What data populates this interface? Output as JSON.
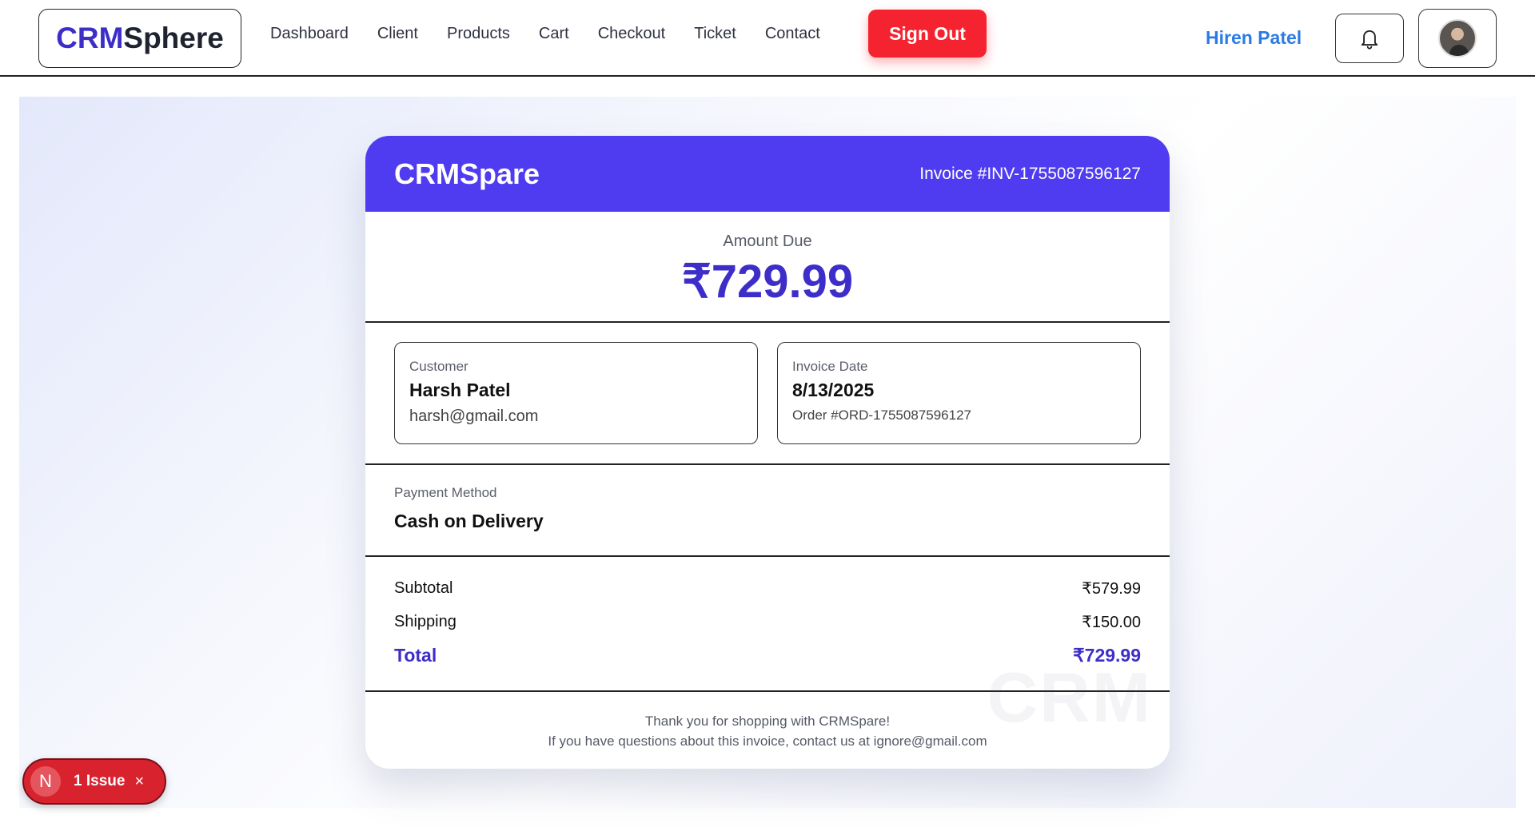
{
  "nav": {
    "logo_part1": "CRM",
    "logo_part2": "Sphere",
    "links": [
      "Dashboard",
      "Client",
      "Products",
      "Cart",
      "Checkout",
      "Ticket",
      "Contact"
    ],
    "signout_label": "Sign Out",
    "user_name": "Hiren Patel"
  },
  "invoice": {
    "brand": "CRMSpare",
    "invoice_number": "Invoice #INV-1755087596127",
    "amount_label": "Amount Due",
    "amount_value": "₹729.99",
    "customer": {
      "label": "Customer",
      "name": "Harsh Patel",
      "email": "harsh@gmail.com"
    },
    "date": {
      "label": "Invoice Date",
      "value": "8/13/2025",
      "order": "Order #ORD-1755087596127"
    },
    "payment": {
      "label": "Payment Method",
      "value": "Cash on Delivery"
    },
    "totals": {
      "subtotal_label": "Subtotal",
      "subtotal_value": "₹579.99",
      "shipping_label": "Shipping",
      "shipping_value": "₹150.00",
      "total_label": "Total",
      "total_value": "₹729.99"
    },
    "footer": {
      "line1": "Thank you for shopping with CRMSpare!",
      "line2": "If you have questions about this invoice, contact us at ignore@gmail.com",
      "watermark": "CRM"
    }
  },
  "issue_badge": {
    "logo": "N",
    "label": "1 Issue",
    "close": "×"
  },
  "colors": {
    "accent": "#4f3cf0",
    "accent_text": "#3d2ec9",
    "signout": "#f5232f",
    "user_name": "#2a7be6",
    "issue": "#d8232f"
  }
}
